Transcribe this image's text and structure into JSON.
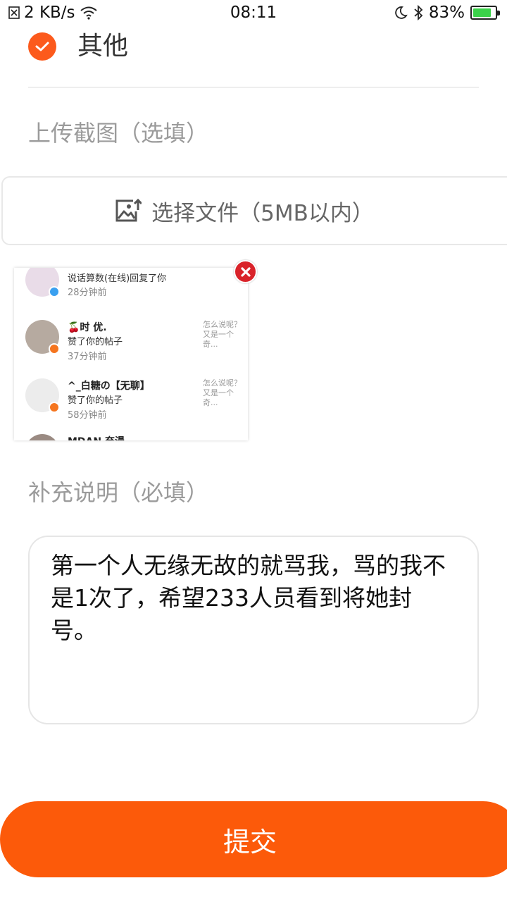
{
  "status_bar": {
    "speed": "2 KB/s",
    "time": "08:11",
    "battery": "83%",
    "battery_level": 0.83
  },
  "option": {
    "label": "其他",
    "checked": true
  },
  "upload": {
    "section_label": "上传截图（选填）",
    "button_label": "选择文件（5MB以内）"
  },
  "thumbnail": {
    "items": [
      {
        "name": "",
        "action": "说话算数(在线)回复了你",
        "time": "28分钟前",
        "snippet": "",
        "badge": "comment",
        "badge_color": "#3aa0f0"
      },
      {
        "name": "🍒时 优.",
        "action": "赞了你的帖子",
        "time": "37分钟前",
        "snippet": "怎么说呢？又是一个奇...",
        "badge": "like",
        "badge_color": "#f5751f"
      },
      {
        "name": "^_白糖の【无聊】",
        "action": "赞了你的帖子",
        "time": "58分钟前",
        "snippet": "怎么说呢？又是一个奇...",
        "badge": "like",
        "badge_color": "#f5751f"
      },
      {
        "name": "MDAN 奈漫",
        "action": "",
        "time": "",
        "snippet": "",
        "badge": "",
        "badge_color": ""
      }
    ]
  },
  "description": {
    "section_label": "补充说明（必填）",
    "value": "第一个人无缘无故的就骂我，骂的我不是1次了，希望233人员看到将她封号。"
  },
  "submit": {
    "label": "提交"
  },
  "colors": {
    "accent": "#fc5a0a",
    "close": "#d9232a"
  }
}
